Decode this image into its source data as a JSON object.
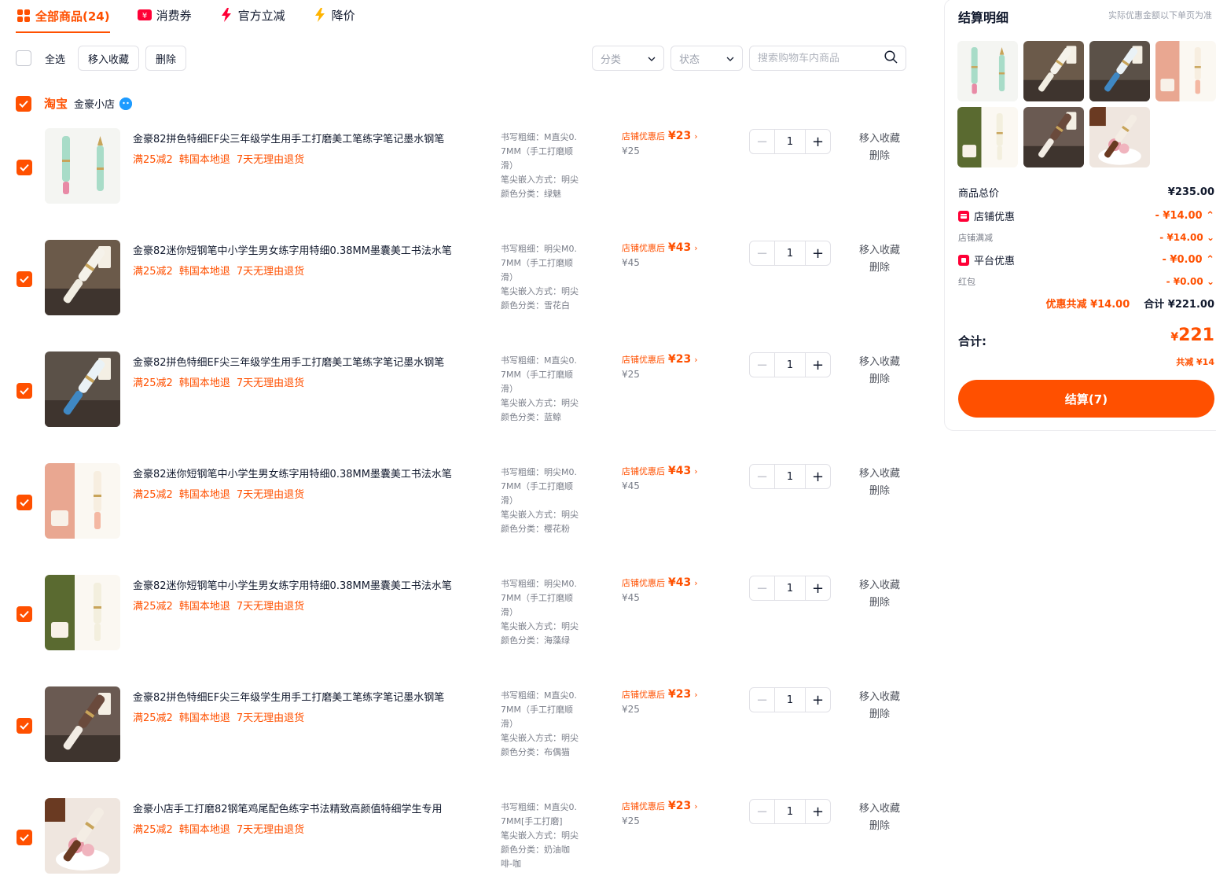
{
  "tabs": [
    {
      "label": "全部商品(24)",
      "icon": "grid-icon"
    },
    {
      "label": "消费券",
      "icon": "coupon-icon"
    },
    {
      "label": "官方立减",
      "icon": "lightning-icon"
    },
    {
      "label": "降价",
      "icon": "bolt-icon"
    }
  ],
  "toolbar": {
    "select_all": "全选",
    "move_to_fav": "移入收藏",
    "delete": "删除",
    "category": "分类",
    "status": "状态",
    "search_placeholder": "搜索购物车内商品"
  },
  "shop": {
    "platform": "淘宝",
    "name": "金豪小店"
  },
  "items": [
    {
      "title": "金豪82拼色特细EF尖三年级学生用手工打磨美工笔练字笔记墨水钢笔",
      "tags": [
        "满25减2",
        "韩国本地退",
        "7天无理由退货"
      ],
      "specs": [
        "书写粗细：M直尖0.",
        "7MM（手工打磨顺",
        "滑）",
        "笔尖嵌入方式：明尖",
        "颜色分类：绿魅"
      ],
      "promo_label": "店铺优惠后",
      "promo_price": "¥23",
      "orig_price": "¥25",
      "qty": "1",
      "action_fav": "移入收藏",
      "action_del": "删除"
    },
    {
      "title": "金豪82迷你短钢笔中小学生男女练字用特细0.38MM墨囊美工书法水笔",
      "tags": [
        "满25减2",
        "韩国本地退",
        "7天无理由退货"
      ],
      "specs": [
        "书写粗细：明尖M0.",
        "7MM（手工打磨顺",
        "滑）",
        "笔尖嵌入方式：明尖",
        "颜色分类：雪花白"
      ],
      "promo_label": "店铺优惠后",
      "promo_price": "¥43",
      "orig_price": "¥45",
      "qty": "1",
      "action_fav": "移入收藏",
      "action_del": "删除"
    },
    {
      "title": "金豪82拼色特细EF尖三年级学生用手工打磨美工笔练字笔记墨水钢笔",
      "tags": [
        "满25减2",
        "韩国本地退",
        "7天无理由退货"
      ],
      "specs": [
        "书写粗细：M直尖0.",
        "7MM（手工打磨顺",
        "滑）",
        "笔尖嵌入方式：明尖",
        "颜色分类：蓝鲸"
      ],
      "promo_label": "店铺优惠后",
      "promo_price": "¥23",
      "orig_price": "¥25",
      "qty": "1",
      "action_fav": "移入收藏",
      "action_del": "删除"
    },
    {
      "title": "金豪82迷你短钢笔中小学生男女练字用特细0.38MM墨囊美工书法水笔",
      "tags": [
        "满25减2",
        "韩国本地退",
        "7天无理由退货"
      ],
      "specs": [
        "书写粗细：明尖M0.",
        "7MM（手工打磨顺",
        "滑）",
        "笔尖嵌入方式：明尖",
        "颜色分类：樱花粉"
      ],
      "promo_label": "店铺优惠后",
      "promo_price": "¥43",
      "orig_price": "¥45",
      "qty": "1",
      "action_fav": "移入收藏",
      "action_del": "删除"
    },
    {
      "title": "金豪82迷你短钢笔中小学生男女练字用特细0.38MM墨囊美工书法水笔",
      "tags": [
        "满25减2",
        "韩国本地退",
        "7天无理由退货"
      ],
      "specs": [
        "书写粗细：明尖M0.",
        "7MM（手工打磨顺",
        "滑）",
        "笔尖嵌入方式：明尖",
        "颜色分类：海藻绿"
      ],
      "promo_label": "店铺优惠后",
      "promo_price": "¥43",
      "orig_price": "¥45",
      "qty": "1",
      "action_fav": "移入收藏",
      "action_del": "删除"
    },
    {
      "title": "金豪82拼色特细EF尖三年级学生用手工打磨美工笔练字笔记墨水钢笔",
      "tags": [
        "满25减2",
        "韩国本地退",
        "7天无理由退货"
      ],
      "specs": [
        "书写粗细：M直尖0.",
        "7MM（手工打磨顺",
        "滑）",
        "笔尖嵌入方式：明尖",
        "颜色分类：布偶猫"
      ],
      "promo_label": "店铺优惠后",
      "promo_price": "¥23",
      "orig_price": "¥25",
      "qty": "1",
      "action_fav": "移入收藏",
      "action_del": "删除"
    },
    {
      "title": "金豪小店手工打磨82钢笔鸡尾配色练字书法精致高颜值特细学生专用",
      "tags": [
        "满25减2",
        "韩国本地退",
        "7天无理由退货"
      ],
      "specs": [
        "书写粗细：M直尖0.",
        "7MM[手工打磨]",
        "笔尖嵌入方式：明尖",
        "颜色分类：奶油咖",
        "啡-咖"
      ],
      "promo_label": "店铺优惠后",
      "promo_price": "¥23",
      "orig_price": "¥25",
      "qty": "1",
      "action_fav": "移入收藏",
      "action_del": "删除"
    }
  ],
  "summary": {
    "title": "结算明细",
    "note": "实际优惠金额以下单页为准",
    "goods_total_label": "商品总价",
    "goods_total": "¥235.00",
    "shop_discount_label": "店铺优惠",
    "shop_discount": "- ¥14.00",
    "shop_full_reduce_label": "店铺满减",
    "shop_full_reduce": "- ¥14.00",
    "platform_discount_label": "平台优惠",
    "platform_discount": "- ¥0.00",
    "red_packet_label": "红包",
    "red_packet": "- ¥0.00",
    "saved_text": "优惠共减 ¥14.00",
    "subtotal_text": "合计 ¥221.00",
    "total_label": "合计:",
    "total_currency": "¥",
    "total_value": "221",
    "total_saved": "共减 ¥14",
    "checkout_label": "结算(7)"
  },
  "colors": {
    "accent": "#ff5000",
    "platform_red": "#ff0036"
  }
}
